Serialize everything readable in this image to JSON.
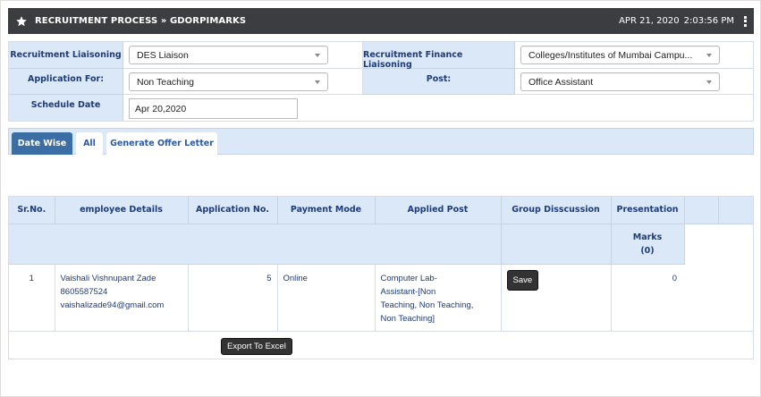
{
  "header": {
    "title": "RECRUITMENT PROCESS » GDORPIMARKS",
    "date": "APR 21, 2020",
    "time": "2:03:56 PM",
    "icon": "star-icon"
  },
  "form": {
    "recruitment_liaisoning_label": "Recruitment Liaisoning",
    "recruitment_liaisoning_value": "DES Liaison",
    "recruitment_finance_label": "Recruitment Finance Liaisoning",
    "recruitment_finance_value": "Colleges/Institutes of Mumbai Campu...",
    "application_for_label": "Application For:",
    "application_for_value": "Non Teaching",
    "post_label": "Post:",
    "post_value": "Office Assistant",
    "schedule_date_label": "Schedule Date",
    "schedule_date_value": "Apr 20,2020"
  },
  "tabs": [
    {
      "label": "Date Wise",
      "active": true
    },
    {
      "label": "All",
      "active": false
    },
    {
      "label": "Generate Offer Letter",
      "active": false
    }
  ],
  "table": {
    "headers": [
      "Sr.No.",
      "employee Details",
      "Application No.",
      "Payment Mode",
      "Applied Post",
      "Group Disscussion",
      "Presentation"
    ],
    "marks_label": "Marks",
    "marks_count": "(0)",
    "rows": [
      {
        "sr": "1",
        "name": "Vaishali Vishnupant Zade",
        "phone": "8605587524",
        "email": "vaishalizade94@gmail.com",
        "application_no": "5",
        "payment_mode": "Online",
        "applied_post_1": "Computer Lab-",
        "applied_post_2": "Assistant-[Non",
        "applied_post_3": "Teaching, Non Teaching,",
        "applied_post_4": "Non Teaching]",
        "save_label": "Save",
        "presentation_value": "0"
      }
    ]
  },
  "export_label": "Export To Excel",
  "colors": {
    "header_bg": "#3c3d40",
    "label_bg": "#dbe8f7",
    "label_text": "#1f3b78",
    "tab_active": "#3a6ea5"
  }
}
